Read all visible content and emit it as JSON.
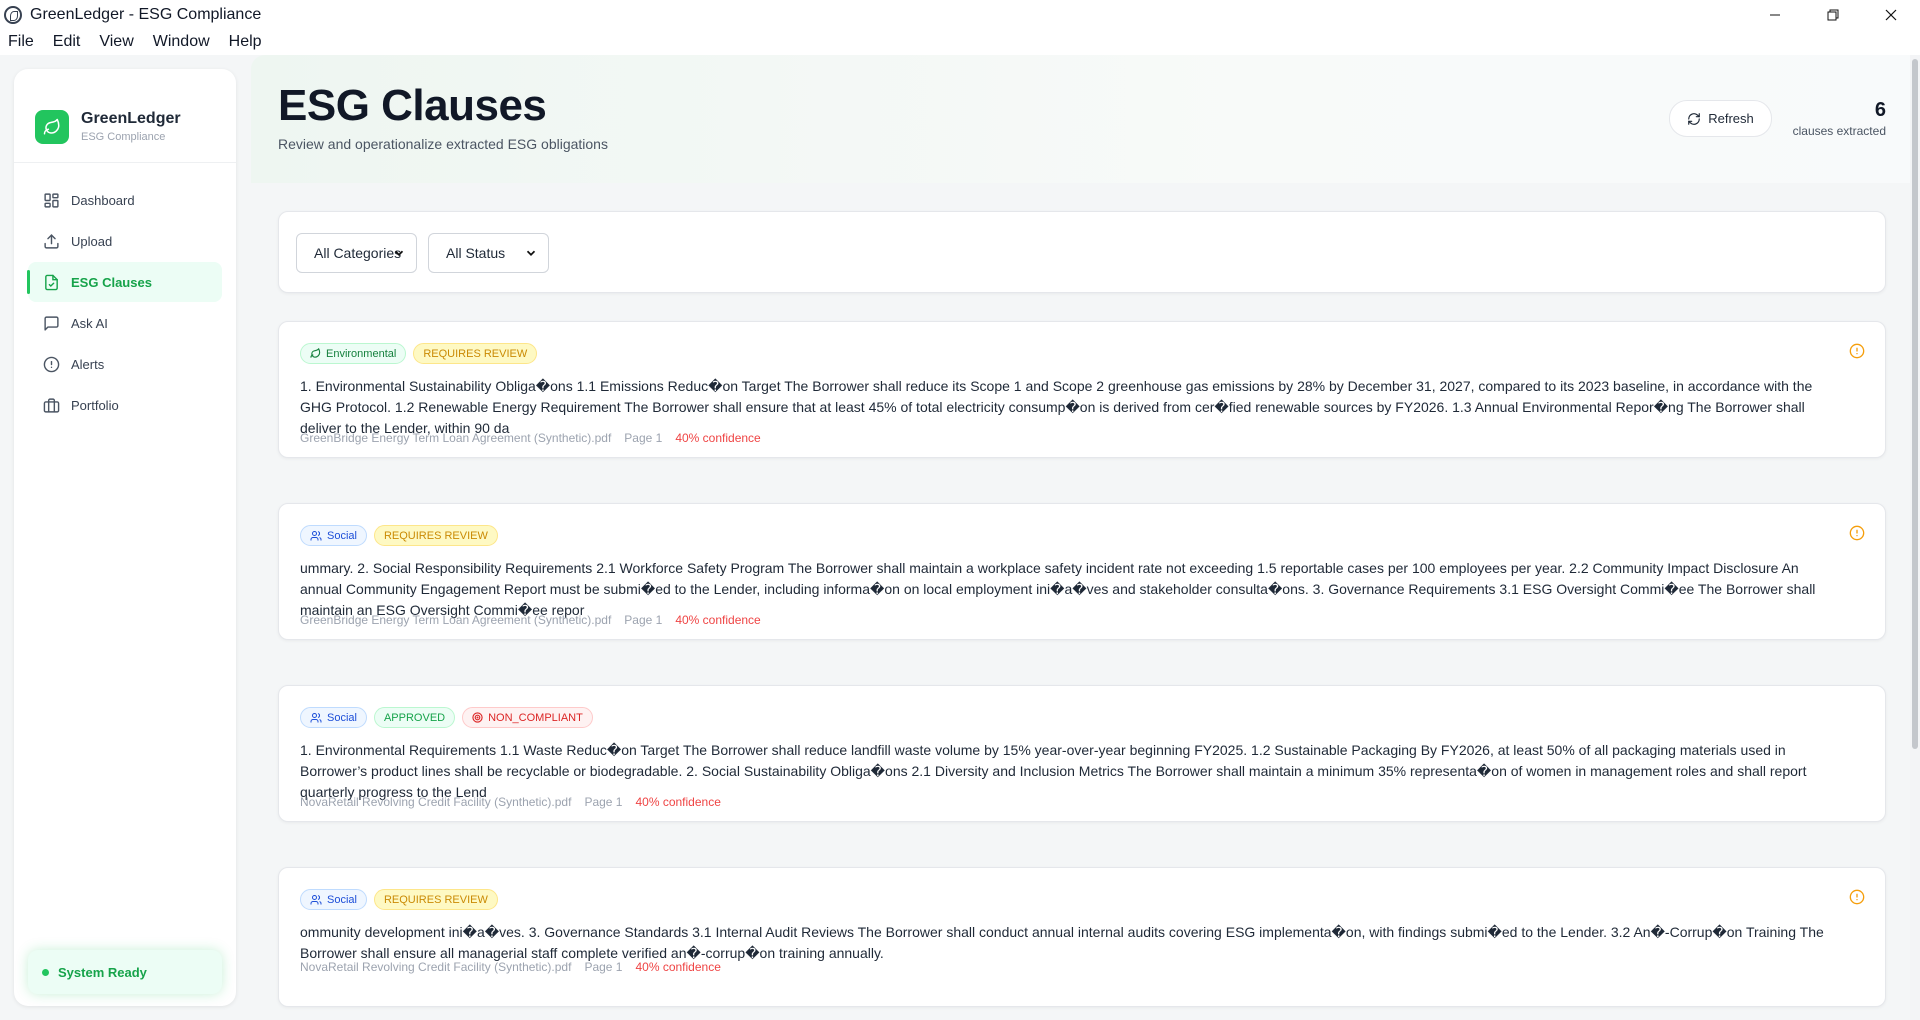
{
  "window": {
    "title": "GreenLedger - ESG Compliance",
    "controls": {
      "minimize": "—",
      "restore": "❐",
      "close": "✕"
    }
  },
  "menu": [
    "File",
    "Edit",
    "View",
    "Window",
    "Help"
  ],
  "brand": {
    "name": "GreenLedger",
    "subtitle": "ESG Compliance",
    "accent": "#22c55e"
  },
  "nav": [
    {
      "label": "Dashboard",
      "icon": "grid-icon"
    },
    {
      "label": "Upload",
      "icon": "upload-icon"
    },
    {
      "label": "ESG Clauses",
      "icon": "document-icon",
      "active": true
    },
    {
      "label": "Ask AI",
      "icon": "chat-icon"
    },
    {
      "label": "Alerts",
      "icon": "alert-circle-icon"
    },
    {
      "label": "Portfolio",
      "icon": "briefcase-icon"
    }
  ],
  "status": {
    "label": "System Ready"
  },
  "header": {
    "title": "ESG Clauses",
    "subtitle": "Review and operationalize extracted ESG obligations",
    "refresh_label": "Refresh",
    "count": "6",
    "count_label": "clauses extracted"
  },
  "filters": {
    "category": "All Categories",
    "status": "All Status"
  },
  "clauses": [
    {
      "category": "Environmental",
      "review_status": "REQUIRES REVIEW",
      "text": "1. Environmental Sustainability Obliga�ons 1.1 Emissions Reduc�on Target The Borrower shall reduce its Scope 1 and Scope 2 greenhouse gas emissions by 28% by December 31, 2027, compared to its 2023 baseline, in accordance with the GHG Protocol. 1.2 Renewable Energy Requirement The Borrower shall ensure that at least 45% of total electricity consump�on is derived from cer�fied renewable sources by FY2026. 1.3 Annual Environmental Repor�ng The Borrower shall deliver to the Lender, within 90 da",
      "source": "GreenBridge Energy Term Loan Agreement (Synthetic).pdf",
      "page": "Page 1",
      "confidence": "40% confidence"
    },
    {
      "category": "Social",
      "review_status": "REQUIRES REVIEW",
      "text": "ummary. 2. Social Responsibility Requirements 2.1 Workforce Safety Program The Borrower shall maintain a workplace safety incident rate not exceeding 1.5 reportable cases per 100 employees per year. 2.2 Community Impact Disclosure An annual Community Engagement Report must be submi�ed to the Lender, including informa�on on local employment ini�a�ves and stakeholder consulta�ons. 3. Governance Requirements 3.1 ESG Oversight Commi�ee The Borrower shall maintain an ESG Oversight Commi�ee repor",
      "source": "GreenBridge Energy Term Loan Agreement (Synthetic).pdf",
      "page": "Page 1",
      "confidence": "40% confidence"
    },
    {
      "category": "Social",
      "review_status": "APPROVED",
      "compliance": "NON_COMPLIANT",
      "text": "1. Environmental Requirements 1.1 Waste Reduc�on Target The Borrower shall reduce landfill waste volume by 15% year-over-year beginning FY2025. 1.2 Sustainable Packaging By FY2026, at least 50% of all packaging materials used in Borrower’s product lines shall be recyclable or biodegradable. 2. Social Sustainability Obliga�ons 2.1 Diversity and Inclusion Metrics The Borrower shall maintain a minimum 35% representa�on of women in management roles and shall report quarterly progress to the Lend",
      "source": "NovaRetail Revolving Credit Facility (Synthetic).pdf",
      "page": "Page 1",
      "confidence": "40% confidence"
    },
    {
      "category": "Social",
      "review_status": "REQUIRES REVIEW",
      "text": "ommunity development ini�a�ves. 3. Governance Standards 3.1 Internal Audit Reviews The Borrower shall conduct annual internal audits covering ESG implementa�on, with findings submi�ed to the Lender. 3.2 An�-Corrup�on Training The Borrower shall ensure all managerial staff complete verified an�-corrup�on training annually.",
      "source": "NovaRetail Revolving Credit Facility (Synthetic).pdf",
      "page": "Page 1",
      "confidence": "40% confidence"
    }
  ]
}
